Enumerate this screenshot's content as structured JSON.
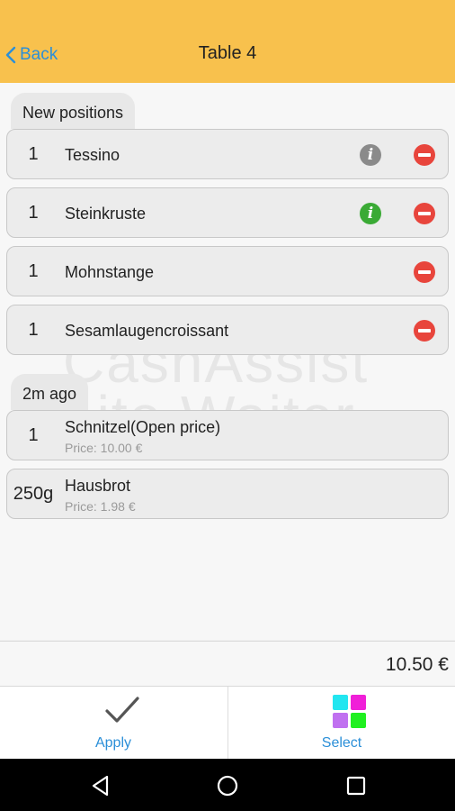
{
  "header": {
    "back_label": "Back",
    "title": "Table 4"
  },
  "watermark": {
    "line1": "CashAssist",
    "line2": "Lite Waiter"
  },
  "sections": {
    "new": {
      "label": "New positions",
      "items": [
        {
          "qty": "1",
          "name": "Tessino",
          "info_icon": "info-gray"
        },
        {
          "qty": "1",
          "name": "Steinkruste",
          "info_icon": "info-green"
        },
        {
          "qty": "1",
          "name": "Mohnstange"
        },
        {
          "qty": "1",
          "name": "Sesamlaugencroissant"
        }
      ]
    },
    "previous": {
      "label": "2m ago",
      "items": [
        {
          "qty": "1",
          "name": "Schnitzel(Open price)",
          "price": "Price: 10.00 €"
        },
        {
          "qty": "250g",
          "name": "Hausbrot",
          "price": "Price: 1.98 €"
        }
      ]
    }
  },
  "total": "10.50 €",
  "actions": {
    "apply_label": "Apply",
    "select_label": "Select"
  },
  "colors": {
    "header_bg": "#f8c14d",
    "accent": "#2b8fd8",
    "remove": "#e8453c",
    "info_gray": "#8a8a8a",
    "info_green": "#3aaa35",
    "select_tiles": [
      "#22e6f0",
      "#f020d8",
      "#c070f0",
      "#20f020"
    ]
  }
}
